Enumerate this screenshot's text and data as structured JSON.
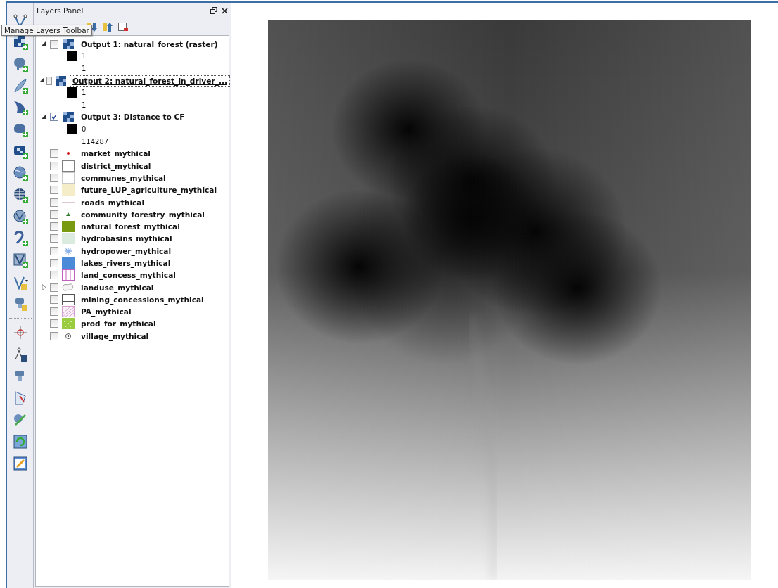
{
  "panel": {
    "title": "Layers Panel"
  },
  "tooltip": "Manage Layers Toolbar",
  "layers": [
    {
      "name": "Output 1: natural_forest (raster)",
      "kind": "raster",
      "checked": false,
      "selected": false,
      "expanded": true,
      "children": [
        {
          "kind": "swatch",
          "label": "1"
        },
        {
          "kind": "text",
          "label": "1"
        }
      ]
    },
    {
      "name": "Output 2: natural_forest_in_driver_...",
      "kind": "raster",
      "checked": false,
      "selected": true,
      "expanded": true,
      "children": [
        {
          "kind": "swatch",
          "label": "1"
        },
        {
          "kind": "text",
          "label": "1"
        }
      ]
    },
    {
      "name": "Output 3: Distance to CF",
      "kind": "raster",
      "checked": true,
      "selected": false,
      "expanded": true,
      "children": [
        {
          "kind": "swatch",
          "label": "0"
        },
        {
          "kind": "text",
          "label": "114287"
        }
      ]
    },
    {
      "name": "market_mythical",
      "kind": "dot",
      "color": "#d01010",
      "checked": false,
      "selected": false
    },
    {
      "name": "district_mythical",
      "kind": "outline",
      "checked": false,
      "selected": false
    },
    {
      "name": "communes_mythical",
      "kind": "dotted",
      "checked": false,
      "selected": false
    },
    {
      "name": "future_LUP_agriculture_mythical",
      "kind": "fill",
      "color": "#f5ecc8",
      "checked": false,
      "selected": false
    },
    {
      "name": "roads_mythical",
      "kind": "line",
      "color": "#e0c8d0",
      "checked": false,
      "selected": false
    },
    {
      "name": "community_forestry_mythical",
      "kind": "triangle",
      "color": "#2e7a2a",
      "checked": false,
      "selected": false
    },
    {
      "name": "natural_forest_mythical",
      "kind": "fill",
      "color": "#789a10",
      "checked": false,
      "selected": false
    },
    {
      "name": "hydrobasins_mythical",
      "kind": "fill",
      "color": "#dcebe0",
      "checked": false,
      "selected": false
    },
    {
      "name": "hydropower_mythical",
      "kind": "star",
      "checked": false,
      "selected": false
    },
    {
      "name": "lakes_rivers_mythical",
      "kind": "fill",
      "color": "#4a8ad8",
      "checked": false,
      "selected": false
    },
    {
      "name": "land_concess_mythical",
      "kind": "vstripes",
      "checked": false,
      "selected": false
    },
    {
      "name": "landuse_mythical",
      "kind": "cloud",
      "checked": false,
      "selected": false,
      "expanded": false
    },
    {
      "name": "mining_concessions_mythical",
      "kind": "hstripes",
      "checked": false,
      "selected": false
    },
    {
      "name": "PA_mythical",
      "kind": "hatch",
      "checked": false,
      "selected": false
    },
    {
      "name": "prod_for_mythical",
      "kind": "dotfill",
      "color": "#9acc40",
      "checked": false,
      "selected": false
    },
    {
      "name": "village_mythical",
      "kind": "circle",
      "checked": false,
      "selected": false
    }
  ]
}
